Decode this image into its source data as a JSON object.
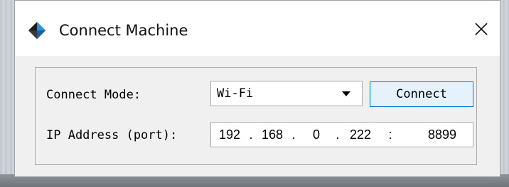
{
  "window": {
    "title": "Connect Machine",
    "close_glyph": "✕"
  },
  "form": {
    "connect_mode_label": "Connect Mode:",
    "connect_mode_value": "Wi-Fi",
    "connect_button_label": "Connect",
    "ip_label": "IP Address (port):",
    "ip": {
      "octet1": "192",
      "octet2": "168",
      "octet3": "0",
      "octet4": "222",
      "dot": ".",
      "colon": ":",
      "port": "8899"
    }
  },
  "icons": {
    "app": "app-logo-icon",
    "close": "close-icon",
    "dropdown": "chevron-down-icon"
  },
  "colors": {
    "button_bg": "#e5f1fb",
    "button_border": "#0078d7",
    "dialog_bg": "#f0f0f0"
  }
}
